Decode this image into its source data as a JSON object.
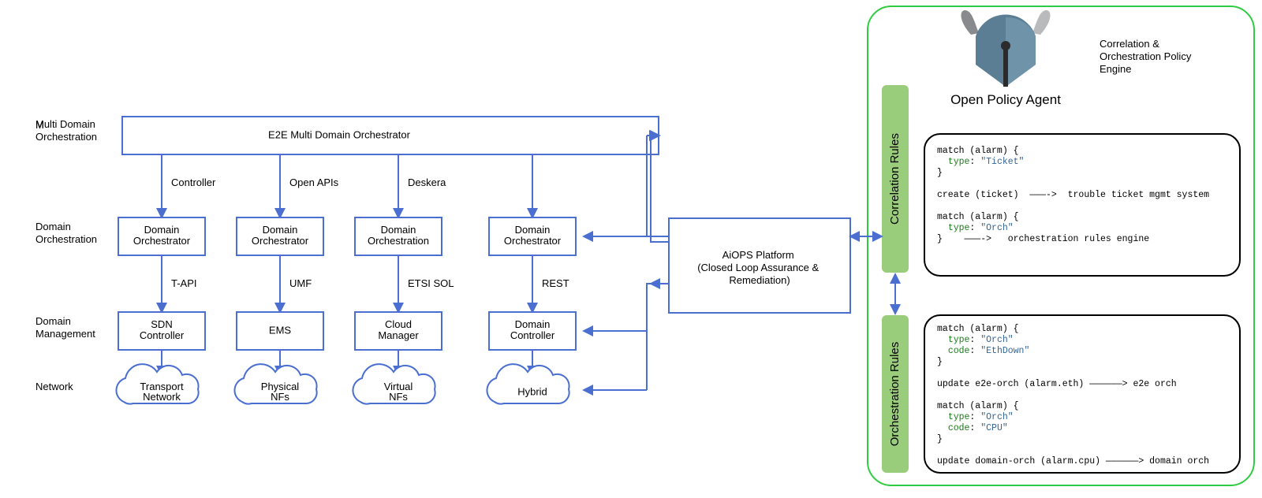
{
  "rows": {
    "multi": "Multi Domain Orchestration",
    "domain": "Domain Orchestration",
    "mgmt": "Domain Management",
    "network": "Network"
  },
  "e2e": "E2E Multi Domain Orchestrator",
  "cols": [
    {
      "edge1": "Controller",
      "domain": "Domain Orchestrator",
      "edge2": "T-API",
      "mgmt": "SDN Controller",
      "net": "Transport Network"
    },
    {
      "edge1": "Open APIs",
      "domain": "Domain Orchestrator",
      "edge2": "UMF",
      "mgmt": "EMS",
      "net": "Physical NFs"
    },
    {
      "edge1": "Deskera",
      "domain": "Domain Orchestration",
      "edge2": "ETSI SOL",
      "mgmt": "Cloud Manager",
      "net": "Virtual NFs"
    },
    {
      "edge1": "",
      "domain": "Domain Orchestrator",
      "edge2": "REST",
      "mgmt": "Domain Controller",
      "net": "Hybrid"
    }
  ],
  "aiops": "AiOPS Platform (Closed Loop Assurance & Remediation)",
  "opa": "Open Policy Agent",
  "tabs": {
    "corr": "Correlation Rules",
    "orch": "Orchestration Rules"
  },
  "policy_header": "Correlation & Orchestration Policy Engine",
  "code1": [
    [
      "match (alarm) {"
    ],
    [
      "  ",
      "type",
      ": ",
      "\"Ticket\""
    ],
    [
      "}"
    ],
    [
      ""
    ],
    [
      "create (ticket)  ———->  trouble ticket mgmt system"
    ],
    [
      ""
    ],
    [
      "match (alarm) {"
    ],
    [
      "  ",
      "type",
      ": ",
      "\"Orch\""
    ],
    [
      "}    ———->   orchestration rules engine"
    ]
  ],
  "code2": [
    [
      "match (alarm) {"
    ],
    [
      "  ",
      "type",
      ": ",
      "\"Orch\""
    ],
    [
      "  ",
      "code",
      ": ",
      "\"EthDown\""
    ],
    [
      "}"
    ],
    [
      ""
    ],
    [
      "update e2e-orch (alarm.eth) ——————> e2e orch"
    ],
    [
      ""
    ],
    [
      "match (alarm) {"
    ],
    [
      "  ",
      "type",
      ": ",
      "\"Orch\""
    ],
    [
      "  ",
      "code",
      ": ",
      "\"CPU\""
    ],
    [
      "}"
    ],
    [
      ""
    ],
    [
      "update domain-orch (alarm.cpu) ——————> domain orch"
    ]
  ]
}
